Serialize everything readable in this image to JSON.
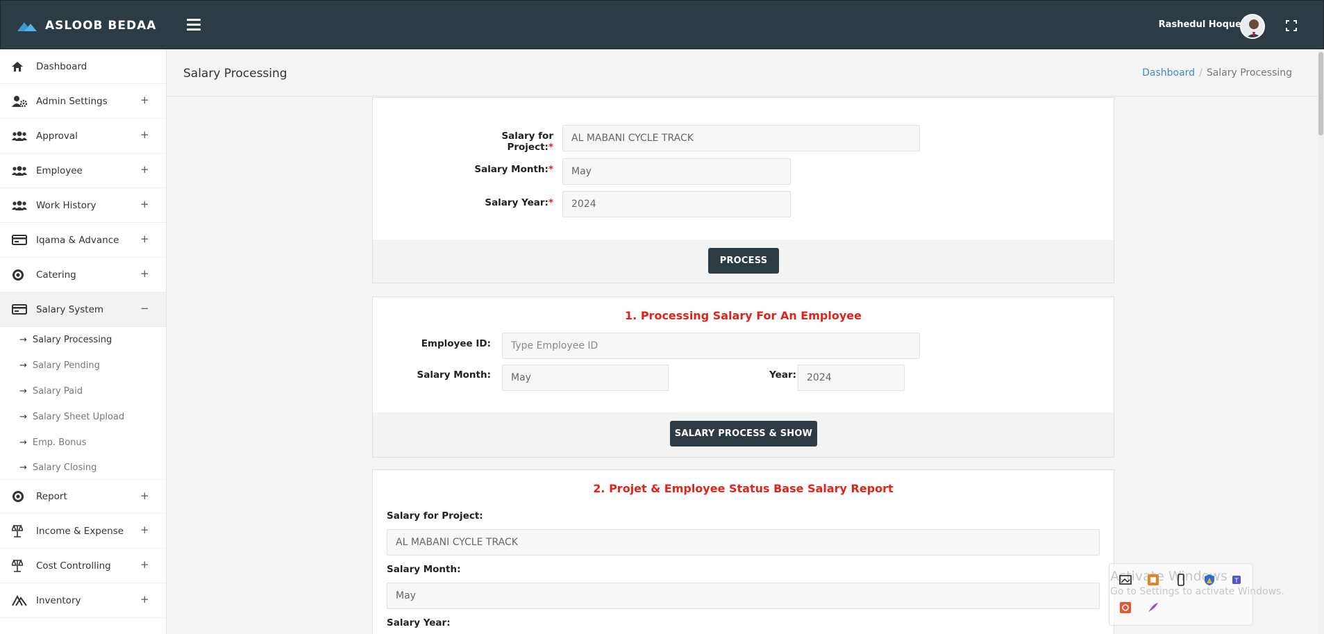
{
  "topbar": {
    "brand": "ASLOOB BEDAA",
    "user_name": "Rashedul Hoque"
  },
  "sidebar": {
    "items": [
      {
        "label": "Dashboard",
        "toggle": ""
      },
      {
        "label": "Admin Settings",
        "toggle": "+"
      },
      {
        "label": "Approval",
        "toggle": "+"
      },
      {
        "label": "Employee",
        "toggle": "+"
      },
      {
        "label": "Work History",
        "toggle": "+"
      },
      {
        "label": "Iqama & Advance",
        "toggle": "+"
      },
      {
        "label": "Catering",
        "toggle": "+"
      },
      {
        "label": "Salary System",
        "toggle": "−"
      },
      {
        "label": "Report",
        "toggle": "+"
      },
      {
        "label": "Income & Expense",
        "toggle": "+"
      },
      {
        "label": "Cost Controlling",
        "toggle": "+"
      },
      {
        "label": "Inventory",
        "toggle": "+"
      }
    ],
    "sub_items": [
      {
        "label": "Salary Processing"
      },
      {
        "label": "Salary Pending"
      },
      {
        "label": "Salary Paid"
      },
      {
        "label": "Salary Sheet Upload"
      },
      {
        "label": "Emp. Bonus"
      },
      {
        "label": "Salary Closing"
      }
    ]
  },
  "header": {
    "title": "Salary Processing",
    "breadcrumb": {
      "home": "Dashboard",
      "separator": "/",
      "current": "Salary Processing"
    }
  },
  "form1": {
    "project_label": "Salary for Project:",
    "project_value": "AL MABANI CYCLE TRACK",
    "month_label": "Salary Month:",
    "month_value": "May",
    "year_label": "Salary Year:",
    "year_value": "2024",
    "required_mark": "*",
    "process_button": "PROCESS"
  },
  "form2": {
    "title": "1. Processing Salary For An Employee",
    "employee_label": "Employee ID:",
    "employee_placeholder": "Type Employee ID",
    "month_label": "Salary Month:",
    "month_value": "May",
    "year_label": "Year:",
    "year_value": "2024",
    "button": "SALARY PROCESS & SHOW"
  },
  "form3": {
    "title": "2. Projet & Employee Status Base Salary Report",
    "project_label": "Salary for Project:",
    "project_value": "AL MABANI CYCLE TRACK",
    "month_label": "Salary Month:",
    "month_value": "May",
    "year_label": "Salary Year:"
  },
  "watermark": {
    "title": "Activate Windows",
    "subtitle": "Go to Settings to activate Windows."
  },
  "colors": {
    "topbar": "#2c3b44",
    "accent_red": "#e2231a",
    "link_blue": "#3c8dbc",
    "button_dark": "#2c3b44"
  }
}
